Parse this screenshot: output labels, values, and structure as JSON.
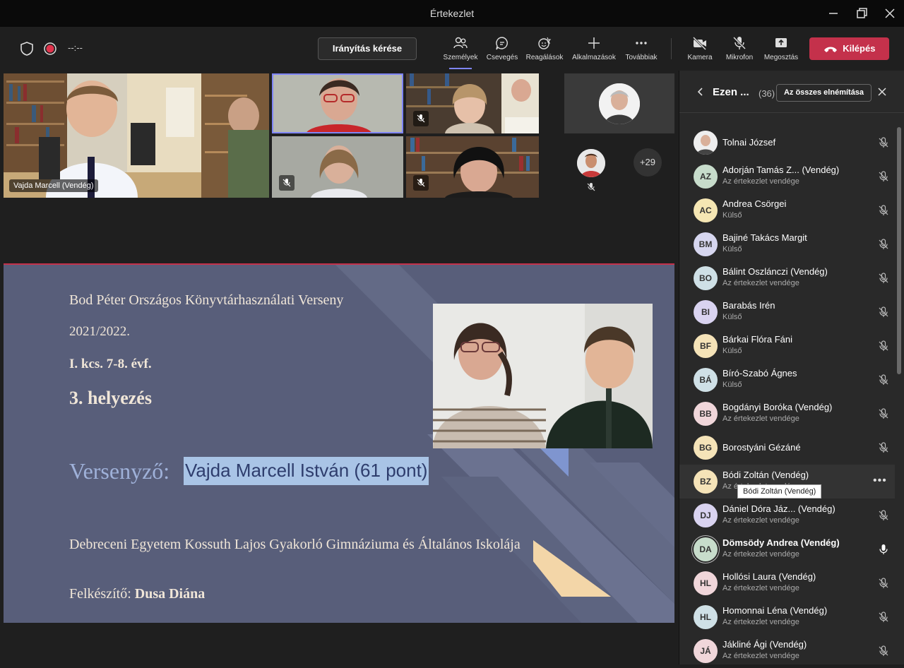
{
  "window": {
    "title": "Értekezlet"
  },
  "toolbar": {
    "timer": "--:--",
    "request_control": "Irányítás kérése",
    "items": [
      {
        "label": "Személyek"
      },
      {
        "label": "Csevegés"
      },
      {
        "label": "Reagálások"
      },
      {
        "label": "Alkalmazások"
      },
      {
        "label": "Továbbiak"
      },
      {
        "label": "Kamera"
      },
      {
        "label": "Mikrofon"
      },
      {
        "label": "Megosztás"
      }
    ],
    "leave": "Kilépés"
  },
  "stage": {
    "main_tile_name": "Vajda Marcell (Vendég)",
    "overflow_count": "+29"
  },
  "slide": {
    "line1": "Bod Péter Országos Könyvtárhasználati Verseny",
    "line2": "2021/2022.",
    "line3": "I. kcs. 7-8. évf.",
    "line4": "3. helyezés",
    "competitor_label": "Versenyző:",
    "competitor_name": "Vajda Marcell István (61 pont)",
    "school": "Debreceni Egyetem Kossuth Lajos Gyakorló Gimnáziuma és Általános Iskolája",
    "prep_label": "Felkészítő:",
    "prep_name": "Dusa Diána"
  },
  "panel": {
    "title": "Ezen ...",
    "count": "(36)",
    "mute_all": "Az összes elnémítása",
    "tooltip": "Bódi Zoltán (Vendég)",
    "participants": [
      {
        "initials": "",
        "name": "Tolnai József",
        "sub": "",
        "color": "#cccccc"
      },
      {
        "initials": "AZ",
        "name": "Adorján Tamás Z... (Vendég)",
        "sub": "Az értekezlet vendége",
        "color": "#c7dccb"
      },
      {
        "initials": "AC",
        "name": "Andrea Csörgei",
        "sub": "Külső",
        "color": "#f5e6b3"
      },
      {
        "initials": "BM",
        "name": "Bajiné Takács Margit",
        "sub": "Külső",
        "color": "#d6d6ef"
      },
      {
        "initials": "BO",
        "name": "Bálint Oszlánczi (Vendég)",
        "sub": "Az értekezlet vendége",
        "color": "#cfe0e6"
      },
      {
        "initials": "BI",
        "name": "Barabás Irén",
        "sub": "Külső",
        "color": "#d9d3f0"
      },
      {
        "initials": "BF",
        "name": "Bárkai Flóra Fáni",
        "sub": "Külső",
        "color": "#f5e3b8"
      },
      {
        "initials": "BÁ",
        "name": "Bíró-Szabó Ágnes",
        "sub": "Külső",
        "color": "#cfe0e6"
      },
      {
        "initials": "BB",
        "name": "Bogdányi Boróka (Vendég)",
        "sub": "Az értekezlet vendége",
        "color": "#f0d6da"
      },
      {
        "initials": "BG",
        "name": "Borostyáni Gézáné",
        "sub": "",
        "color": "#f5e3b8"
      },
      {
        "initials": "BZ",
        "name": "Bódi Zoltán (Vendég)",
        "sub": "Az értekezlet vendége",
        "color": "#f5e3b8"
      },
      {
        "initials": "DJ",
        "name": "Dániel Dóra Jáz...  (Vendég)",
        "sub": "Az értekezlet vendége",
        "color": "#d9d3f0"
      },
      {
        "initials": "DA",
        "name": "Dömsödy Andrea (Vendég)",
        "sub": "Az értekezlet vendége",
        "color": "#c7dccb"
      },
      {
        "initials": "HL",
        "name": "Hollósi Laura (Vendég)",
        "sub": "Az értekezlet vendége",
        "color": "#f0d6da"
      },
      {
        "initials": "HL",
        "name": "Homonnai Léna (Vendég)",
        "sub": "Az értekezlet vendége",
        "color": "#cfe0e6"
      },
      {
        "initials": "JÁ",
        "name": "Jákliné Ági (Vendég)",
        "sub": "Az értekezlet vendége",
        "color": "#f0d6da"
      }
    ]
  },
  "icons": {
    "shield": "shield-icon",
    "record": "record-icon",
    "people": "people-icon",
    "chat": "chat-icon",
    "reactions": "reactions-icon",
    "apps": "plus-icon",
    "more": "more-icon",
    "camera": "camera-off-icon",
    "mic": "mic-off-icon",
    "share": "share-icon",
    "phone": "phone-icon"
  },
  "colors": {
    "accent": "#7f85f5",
    "leave": "#c4314b",
    "slide_bg": "#585e7a",
    "highlight": "#a9c4e6"
  }
}
